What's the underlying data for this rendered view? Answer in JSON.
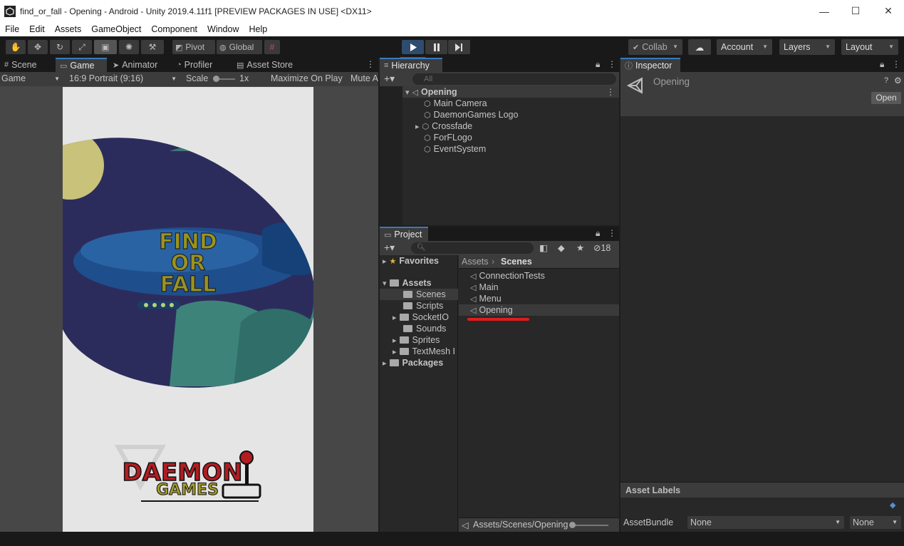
{
  "window": {
    "title": "find_or_fall - Opening - Android - Unity 2019.4.11f1 [PREVIEW PACKAGES IN USE] <DX11>"
  },
  "menu": [
    "File",
    "Edit",
    "Assets",
    "GameObject",
    "Component",
    "Window",
    "Help"
  ],
  "toolbar": {
    "pivot": "Pivot",
    "global": "Global",
    "collab": "Collab",
    "account": "Account",
    "layers": "Layers",
    "layout": "Layout"
  },
  "left_tabs": [
    "Scene",
    "Game",
    "Animator",
    "Profiler",
    "Asset Store"
  ],
  "game_bar": {
    "display": "Game",
    "aspect": "16:9 Portrait (9:16)",
    "scale_label": "Scale",
    "scale_value": "1x",
    "maximize": "Maximize On Play",
    "mute": "Mute A"
  },
  "game_view": {
    "logo_lines": [
      "FIND",
      "OR",
      "FALL"
    ],
    "studio_top": "DAEMON",
    "studio_bottom": "GAMES"
  },
  "hierarchy": {
    "title": "Hierarchy",
    "search_placeholder": "All",
    "scene": "Opening",
    "items": [
      "Main Camera",
      "DaemonGames Logo",
      "Crossfade",
      "ForFLogo",
      "EventSystem"
    ]
  },
  "project": {
    "title": "Project",
    "hidden_count": "18",
    "favorites": "Favorites",
    "assets": "Assets",
    "folders": [
      "Scenes",
      "Scripts",
      "SocketIO",
      "Sounds",
      "Sprites",
      "TextMesh I"
    ],
    "packages": "Packages",
    "breadcrumb_root": "Assets",
    "breadcrumb_current": "Scenes",
    "files": [
      "ConnectionTests",
      "Main",
      "Menu",
      "Opening"
    ],
    "status_path": "Assets/Scenes/Opening"
  },
  "inspector": {
    "title": "Inspector",
    "object_name": "Opening",
    "open_button": "Open",
    "asset_labels": "Asset Labels",
    "asset_bundle_label": "AssetBundle",
    "bundle_value": "None",
    "variant_value": "None"
  },
  "colors": {
    "accent_red": "#e01c1c",
    "selection": "#2c5d87",
    "play_active": "#2e4c6e"
  }
}
